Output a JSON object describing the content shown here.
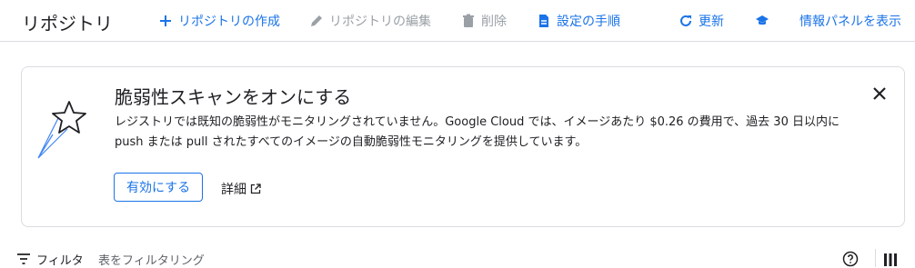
{
  "header": {
    "title": "リポジトリ",
    "create_label": "リポジトリの作成",
    "edit_label": "リポジトリの編集",
    "delete_label": "削除",
    "setup_label": "設定の手順",
    "refresh_label": "更新",
    "learn_icon": "school-icon",
    "info_panel_label": "情報パネルを表示"
  },
  "banner": {
    "title": "脆弱性スキャンをオンにする",
    "body_line1": "レジストリでは既知の脆弱性がモニタリングされていません。Google Cloud では、イメージあたり $0.26 の費用で、過去 30 日以内に",
    "body_line2": "push または pull されたすべてのイメージの自動脆弱性モニタリングを提供しています。",
    "enable_label": "有効にする",
    "details_label": "詳細"
  },
  "filter": {
    "label": "フィルタ",
    "placeholder": "表をフィルタリング"
  },
  "colors": {
    "accent": "#1a73e8",
    "disabled": "#9aa0a6",
    "border": "#dadce0"
  }
}
